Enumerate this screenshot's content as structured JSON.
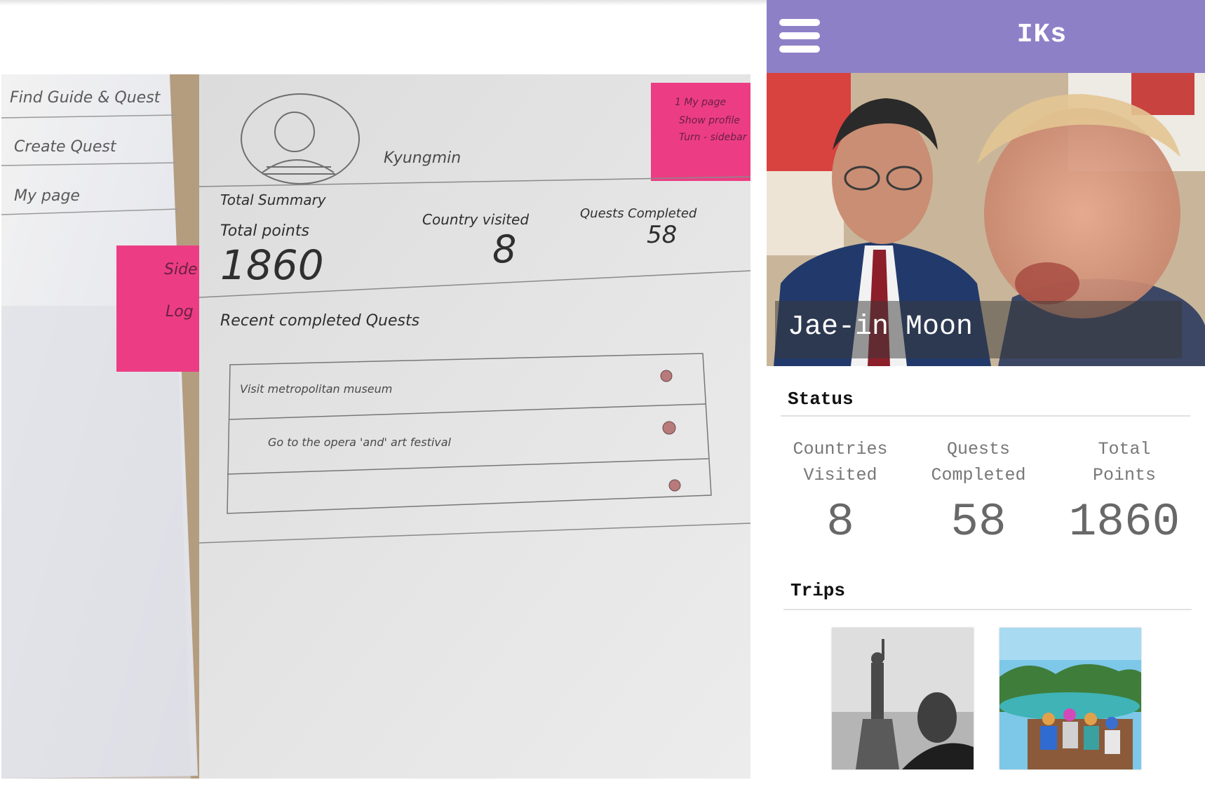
{
  "prototype_photo": {
    "sidebar_items": [
      "Find Guide & Quest",
      "Create Quest",
      "My page"
    ],
    "sticky_note_left": [
      "Side",
      "Log"
    ],
    "sticky_note_right": [
      "1 My page",
      "Show profile",
      "Turn - sidebar"
    ],
    "profile_name": "Kyungmin",
    "summary_title": "Total Summary",
    "total_points_label": "Total points",
    "total_points_value": "1860",
    "country_visited_label": "Country visited",
    "country_visited_value": "8",
    "quests_completed_label": "Quests Completed",
    "quests_completed_value": "58",
    "recent_title": "Recent completed Quests",
    "recent_items": [
      "Visit metropolitan museum",
      "Go to the opera 'and' art festival",
      ""
    ]
  },
  "app": {
    "title": "IKs",
    "menu_icon": "hamburger-menu-icon",
    "colors": {
      "appbar": "#8e80c7",
      "text": "#777777"
    },
    "profile": {
      "name": "Jae-in Moon"
    },
    "status": {
      "title": "Status",
      "stats": [
        {
          "label": "Countries\nVisited",
          "value": "8"
        },
        {
          "label": "Quests\nCompleted",
          "value": "58"
        },
        {
          "label": "Total\nPoints",
          "value": "1860"
        }
      ]
    },
    "trips": {
      "title": "Trips"
    }
  }
}
